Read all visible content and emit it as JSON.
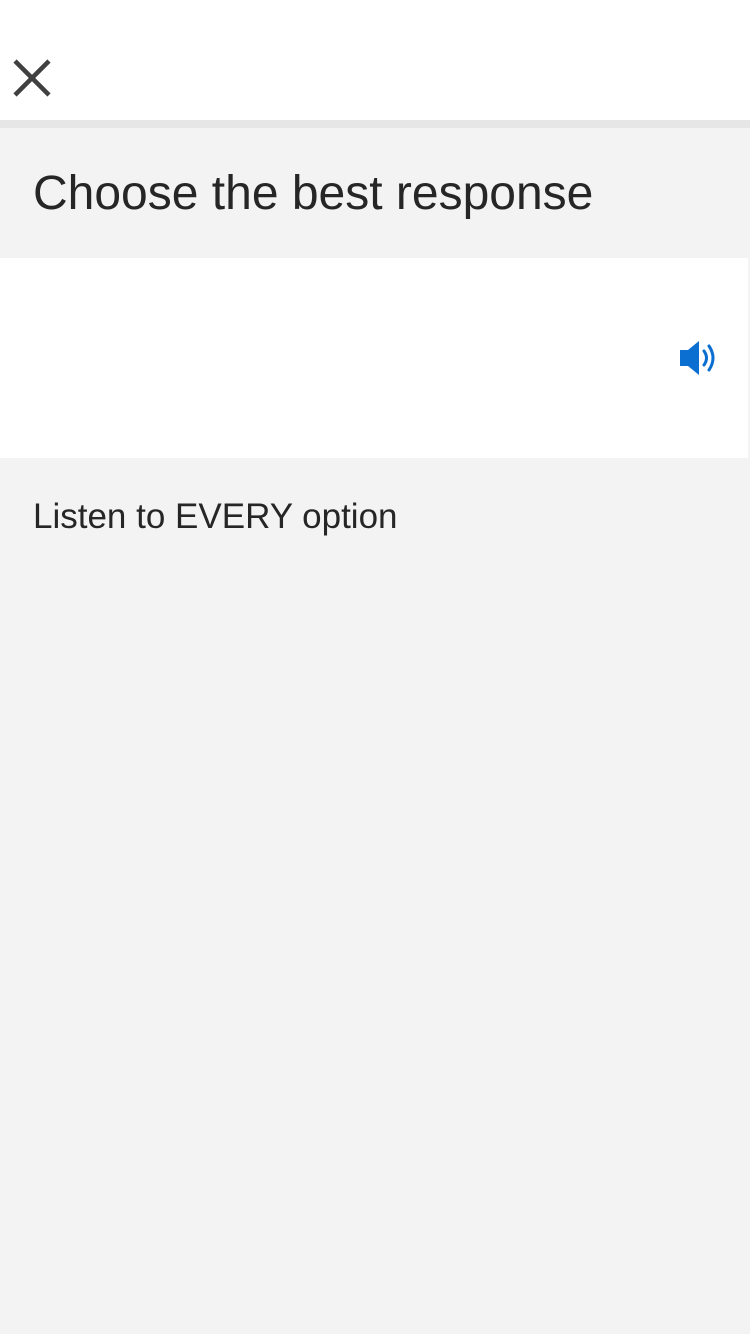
{
  "header": {
    "close_icon": "close-icon"
  },
  "prompt": {
    "title": "Choose the best response"
  },
  "audio": {
    "icon": "speaker-icon",
    "accent_color": "#0a6fd1"
  },
  "instruction": {
    "text": "Listen to EVERY option"
  },
  "colors": {
    "background": "#f3f3f3",
    "card": "#ffffff",
    "text": "#262626"
  }
}
